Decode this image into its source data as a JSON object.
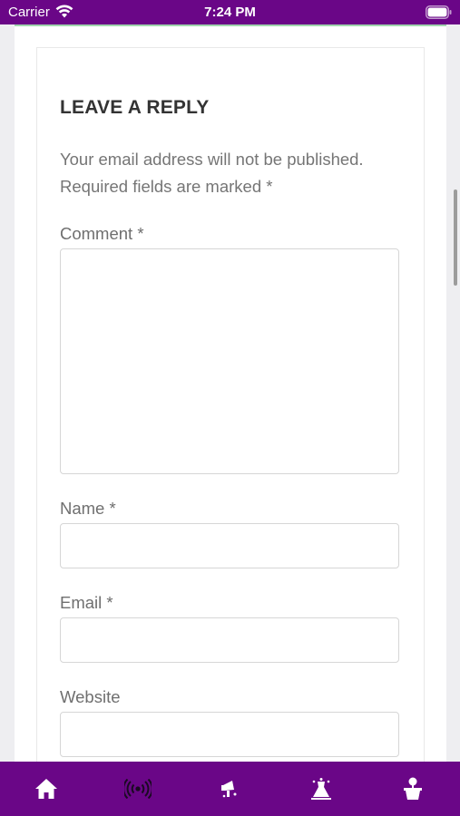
{
  "status_bar": {
    "carrier": "Carrier",
    "time": "7:24 PM"
  },
  "reply_form": {
    "title": "LEAVE A REPLY",
    "notes_line1": "Your email address will not be published.",
    "notes_line2": "Required fields are marked *",
    "comment_label": "Comment *",
    "name_label": "Name *",
    "email_label": "Email *",
    "website_label": "Website",
    "comment_value": "",
    "name_value": "",
    "email_value": "",
    "website_value": ""
  },
  "tab_bar": {
    "tabs": [
      {
        "icon": "home-icon",
        "selected": true
      },
      {
        "icon": "broadcast-icon",
        "selected": false
      },
      {
        "icon": "megaphone-icon",
        "selected": false
      },
      {
        "icon": "dress-icon",
        "selected": false
      },
      {
        "icon": "potted-plant-icon",
        "selected": false
      }
    ]
  },
  "colors": {
    "brand": "#6a0687",
    "accent_line": "#52b36a",
    "text_muted": "#757575"
  }
}
